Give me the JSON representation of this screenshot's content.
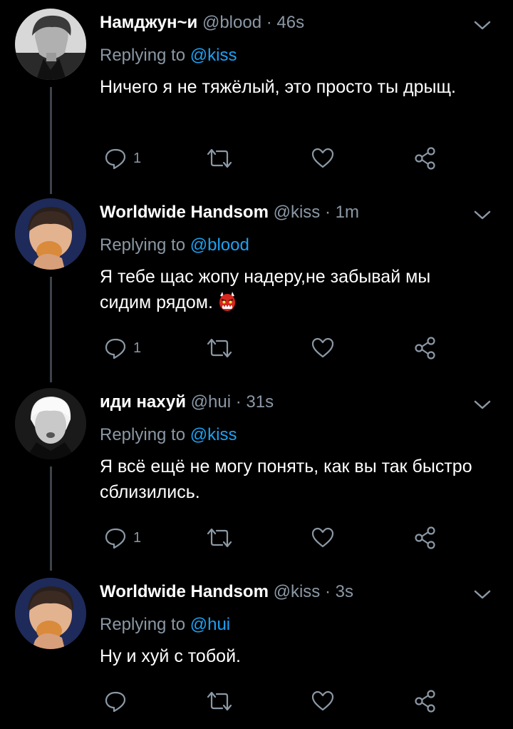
{
  "tweets": [
    {
      "name": "Намджун~и",
      "handle": "@blood",
      "time": "46s",
      "reply_prefix": "Replying to",
      "reply_to": "@kiss",
      "text": "Ничего я не тяжёлый, это просто ты дрыщ.",
      "reply_count": "1",
      "avatar_icon": "grayscale-portrait-avatar"
    },
    {
      "name": "Worldwide Handsom",
      "handle": "@kiss",
      "time": "1m",
      "reply_prefix": "Replying to",
      "reply_to": "@blood",
      "text": "Я тебе щас жопу надеру,не забывай мы сидим рядом.",
      "emoji": "japanese-ogre-emoji",
      "reply_count": "1",
      "avatar_icon": "eating-portrait-avatar"
    },
    {
      "name": "иди нахуй",
      "handle": "@hui",
      "time": "31s",
      "reply_prefix": "Replying to",
      "reply_to": "@kiss",
      "text": "Я всё ещё не могу понять, как вы так быстро сблизились.",
      "reply_count": "1",
      "avatar_icon": "grayscale-portrait-avatar"
    },
    {
      "name": "Worldwide Handsom",
      "handle": "@kiss",
      "time": "3s",
      "reply_prefix": "Replying to",
      "reply_to": "@hui",
      "text": "Ну и хуй с тобой.",
      "reply_count": "",
      "avatar_icon": "eating-portrait-avatar"
    }
  ],
  "colors": {
    "background": "#000000",
    "text": "#ffffff",
    "secondary": "#8b98a5",
    "link": "#1da1f2",
    "thread_line": "#3d4349"
  }
}
